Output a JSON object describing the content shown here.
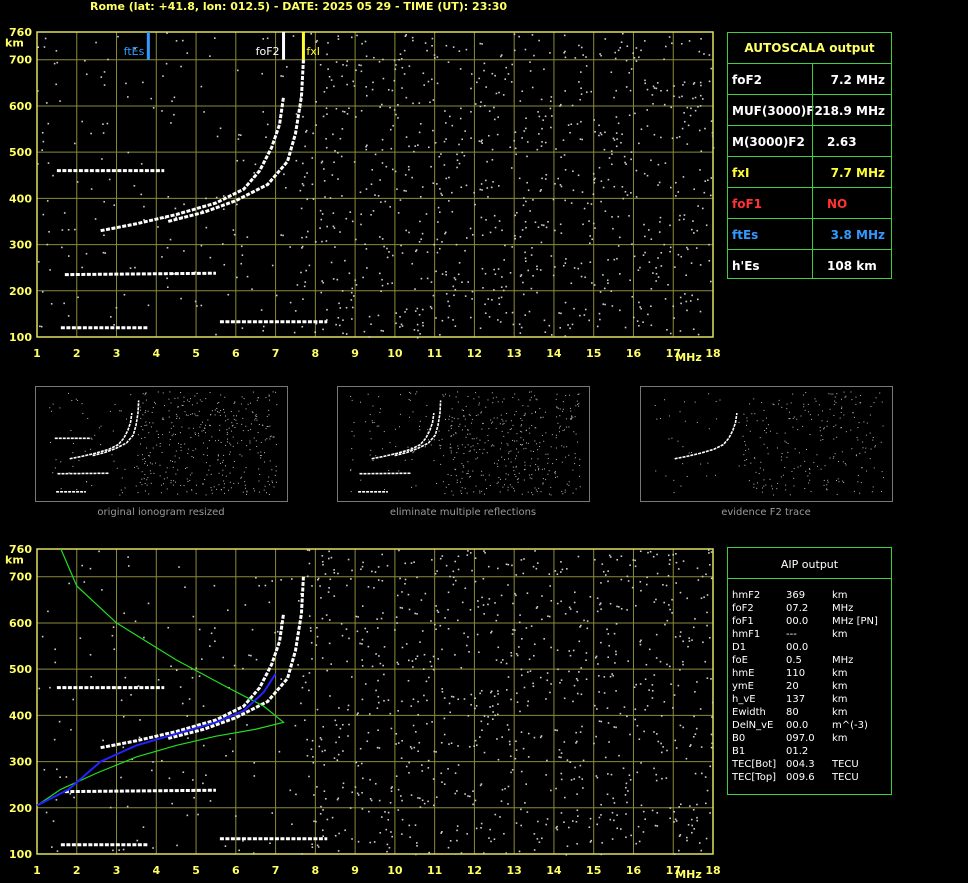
{
  "header": "Rome (lat: +41.8, lon: 012.5) - DATE: 2025 05 29 - TIME (UT): 23:30",
  "colors": {
    "grid": "#8a8a3a",
    "frame": "#e0e060",
    "trace": "#ffffff",
    "fof2": "#ffffff",
    "fxi": "#ffff33",
    "ftes": "#3399ff",
    "profile": "#22dd22",
    "blue_fit": "#2222ff",
    "table_border": "#3fcf3f",
    "noarrow": "#ff3333"
  },
  "chart_data": [
    {
      "type": "scatter",
      "name": "top-ionogram",
      "xlabel": "MHz",
      "ylabel": "km",
      "xlim": [
        1,
        18
      ],
      "ylim": [
        100,
        760
      ],
      "x_ticks": [
        "1",
        "2",
        "3",
        "4",
        "5",
        "6",
        "7",
        "8",
        "9",
        "10",
        "11",
        "12",
        "13",
        "14",
        "15",
        "16",
        "17",
        "18"
      ],
      "y_ticks": [
        "100",
        "200",
        "300",
        "400",
        "500",
        "600",
        "700",
        "760"
      ],
      "markers": [
        {
          "label": "ftEs",
          "x": 3.8,
          "color": "#3399ff"
        },
        {
          "label": "foF2",
          "x": 7.2,
          "color": "#ffffff"
        },
        {
          "label": "fxI",
          "x": 7.7,
          "color": "#ffff33"
        }
      ],
      "traces": {
        "o_mode": [
          [
            2.6,
            330
          ],
          [
            3.5,
            345
          ],
          [
            4.5,
            365
          ],
          [
            5.5,
            390
          ],
          [
            6.2,
            420
          ],
          [
            6.6,
            460
          ],
          [
            6.9,
            510
          ],
          [
            7.1,
            560
          ],
          [
            7.2,
            620
          ]
        ],
        "x_mode": [
          [
            4.3,
            350
          ],
          [
            5.2,
            370
          ],
          [
            6.0,
            395
          ],
          [
            6.8,
            430
          ],
          [
            7.3,
            480
          ],
          [
            7.5,
            540
          ],
          [
            7.65,
            620
          ],
          [
            7.7,
            700
          ]
        ],
        "es_layer": [
          [
            1.6,
            120
          ],
          [
            3.8,
            120
          ]
        ],
        "es_2": [
          [
            1.7,
            235
          ],
          [
            5.5,
            238
          ]
        ],
        "es_3": [
          [
            1.5,
            460
          ],
          [
            4.2,
            460
          ]
        ],
        "e_low": [
          [
            5.6,
            133
          ],
          [
            8.3,
            133
          ]
        ]
      }
    },
    {
      "type": "scatter",
      "name": "bottom-ionogram",
      "xlabel": "MHz",
      "ylabel": "km",
      "xlim": [
        1,
        18
      ],
      "ylim": [
        100,
        760
      ],
      "x_ticks": [
        "1",
        "2",
        "3",
        "4",
        "5",
        "6",
        "7",
        "8",
        "9",
        "10",
        "11",
        "12",
        "13",
        "14",
        "15",
        "16",
        "17",
        "18"
      ],
      "y_ticks": [
        "100",
        "200",
        "300",
        "400",
        "500",
        "600",
        "700",
        "760"
      ],
      "traces": {
        "o_mode": [
          [
            2.6,
            330
          ],
          [
            3.5,
            345
          ],
          [
            4.5,
            365
          ],
          [
            5.5,
            390
          ],
          [
            6.2,
            420
          ],
          [
            6.6,
            460
          ],
          [
            6.9,
            510
          ],
          [
            7.1,
            560
          ],
          [
            7.2,
            620
          ]
        ],
        "x_mode": [
          [
            4.3,
            350
          ],
          [
            5.2,
            370
          ],
          [
            6.0,
            395
          ],
          [
            6.8,
            430
          ],
          [
            7.3,
            480
          ],
          [
            7.5,
            540
          ],
          [
            7.65,
            620
          ],
          [
            7.7,
            700
          ]
        ],
        "es_layer": [
          [
            1.6,
            120
          ],
          [
            3.8,
            120
          ]
        ],
        "es_2": [
          [
            1.7,
            235
          ],
          [
            5.5,
            238
          ]
        ],
        "es_3": [
          [
            1.5,
            460
          ],
          [
            4.2,
            460
          ]
        ],
        "e_low": [
          [
            5.6,
            133
          ],
          [
            8.3,
            133
          ]
        ]
      },
      "profile_curve": [
        [
          1.6,
          760
        ],
        [
          2.0,
          680
        ],
        [
          3.0,
          600
        ],
        [
          4.5,
          520
        ],
        [
          5.8,
          460
        ],
        [
          6.7,
          420
        ],
        [
          7.2,
          385
        ],
        [
          6.5,
          370
        ],
        [
          5.5,
          355
        ],
        [
          4.5,
          335
        ],
        [
          3.5,
          310
        ],
        [
          2.5,
          275
        ],
        [
          1.6,
          240
        ],
        [
          1.0,
          205
        ]
      ],
      "blue_fit": [
        [
          1.0,
          205
        ],
        [
          1.8,
          240
        ],
        [
          2.6,
          300
        ],
        [
          3.5,
          335
        ],
        [
          4.5,
          360
        ],
        [
          5.5,
          385
        ],
        [
          6.2,
          410
        ],
        [
          6.7,
          450
        ],
        [
          7.0,
          490
        ]
      ]
    }
  ],
  "thumbnails": [
    {
      "caption": "original ionogram resized"
    },
    {
      "caption": "eliminate multiple reflections"
    },
    {
      "caption": "evidence F2 trace"
    }
  ],
  "autoscala": {
    "title": "AUTOSCALA output",
    "rows": [
      {
        "name": "foF2",
        "value": "7.2 MHz",
        "color": "#ffffff",
        "vcolor": "#ffffff"
      },
      {
        "name": "MUF(3000)F2",
        "value": "18.9 MHz",
        "color": "#ffffff",
        "vcolor": "#ffffff"
      },
      {
        "name": "M(3000)F2",
        "value": "2.63",
        "color": "#ffffff",
        "vcolor": "#ffffff"
      },
      {
        "name": "fxI",
        "value": "7.7 MHz",
        "color": "#ffff33",
        "vcolor": "#ffff33"
      },
      {
        "name": "foF1",
        "value": "NO",
        "color": "#ff3333",
        "vcolor": "#ff3333"
      },
      {
        "name": "ftEs",
        "value": "3.8 MHz",
        "color": "#3399ff",
        "vcolor": "#3399ff"
      },
      {
        "name": "h'Es",
        "value": "108    km",
        "color": "#ffffff",
        "vcolor": "#ffffff"
      }
    ]
  },
  "aip": {
    "title": "AIP output",
    "rows": [
      {
        "name": "hmF2",
        "value": "369",
        "unit": "km"
      },
      {
        "name": "foF2",
        "value": "07.2",
        "unit": "MHz"
      },
      {
        "name": "foF1",
        "value": "00.0",
        "unit": "MHz   [PN]"
      },
      {
        "name": "hmF1",
        "value": "---",
        "unit": "km"
      },
      {
        "name": "D1",
        "value": "00.0",
        "unit": ""
      },
      {
        "name": "foE",
        "value": "0.5",
        "unit": "MHz"
      },
      {
        "name": "hmE",
        "value": "110",
        "unit": "km"
      },
      {
        "name": "ymE",
        "value": "20",
        "unit": "km"
      },
      {
        "name": "h_vE",
        "value": "137",
        "unit": "km"
      },
      {
        "name": "Ewidth",
        "value": "80",
        "unit": "km"
      },
      {
        "name": "DelN_vE",
        "value": "00.0",
        "unit": "m^(-3)"
      },
      {
        "name": "B0",
        "value": "097.0",
        "unit": "km"
      },
      {
        "name": "B1",
        "value": "01.2",
        "unit": ""
      },
      {
        "name": "TEC[Bot]",
        "value": "004.3",
        "unit": "TECU"
      },
      {
        "name": "TEC[Top]",
        "value": "009.6",
        "unit": "TECU"
      }
    ]
  }
}
